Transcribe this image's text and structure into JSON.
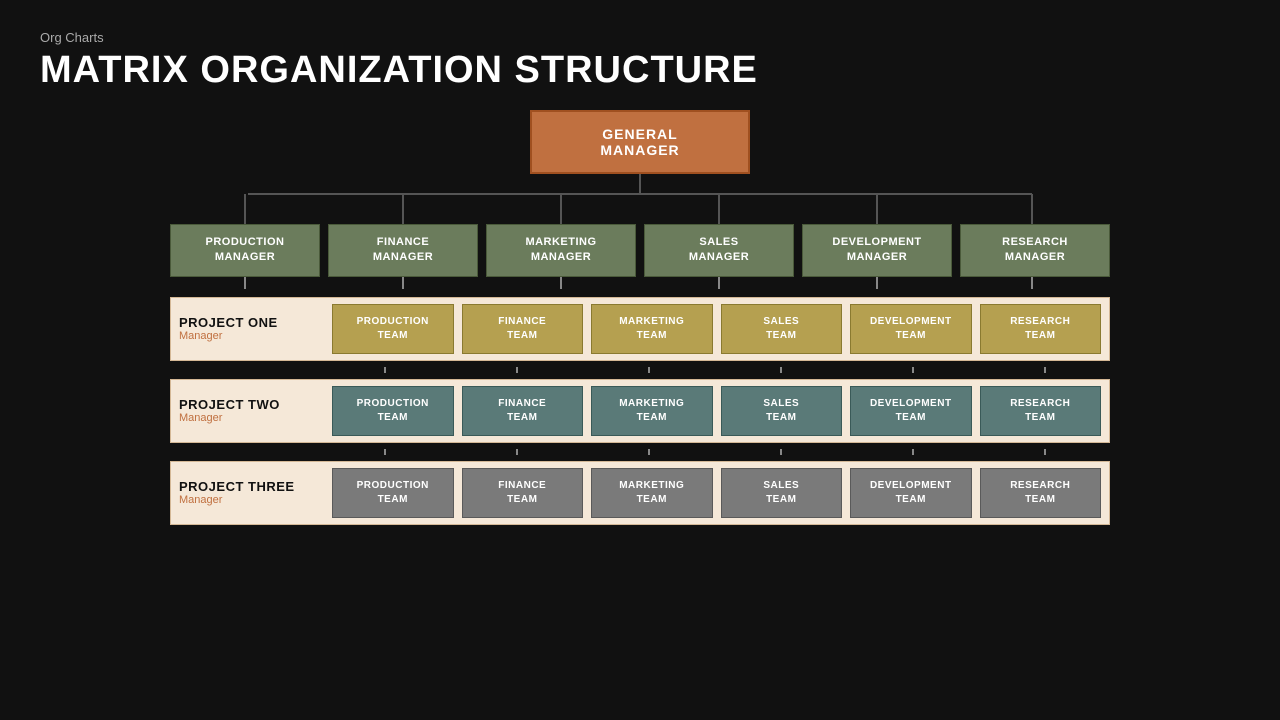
{
  "header": {
    "subtitle": "Org  Charts",
    "title": "MATRIX ORGANIZATION STRUCTURE"
  },
  "gm": {
    "label": "GENERAL MANAGER"
  },
  "managers": [
    {
      "label": "PRODUCTION\nMANAGER"
    },
    {
      "label": "FINANCE\nMANAGER"
    },
    {
      "label": "MARKETING\nMANAGER"
    },
    {
      "label": "SALES\nMANAGER"
    },
    {
      "label": "DEVELOPMENT\nMANAGER"
    },
    {
      "label": "RESEARCH\nMANAGER"
    }
  ],
  "projects": [
    {
      "name": "PROJECT ONE",
      "manager": "Manager",
      "style": "gold",
      "teams": [
        "PRODUCTION\nTEAM",
        "FINANCE\nTEAM",
        "MARKETING\nTEAM",
        "SALES\nTEAM",
        "DEVELOPMENT\nTEAM",
        "RESEARCH\nTEAM"
      ]
    },
    {
      "name": "PROJECT TWO",
      "manager": "Manager",
      "style": "teal",
      "teams": [
        "PRODUCTION\nTEAM",
        "FINANCE\nTEAM",
        "MARKETING\nTEAM",
        "SALES\nTEAM",
        "DEVELOPMENT\nTEAM",
        "RESEARCH\nTEAM"
      ]
    },
    {
      "name": "PROJECT THREE",
      "manager": "Manager",
      "style": "gray",
      "teams": [
        "PRODUCTION\nTEAM",
        "FINANCE\nTEAM",
        "MARKETING\nTEAM",
        "SALES\nTEAM",
        "DEVELOPMENT\nTEAM",
        "RESEARCH\nTEAM"
      ]
    }
  ]
}
